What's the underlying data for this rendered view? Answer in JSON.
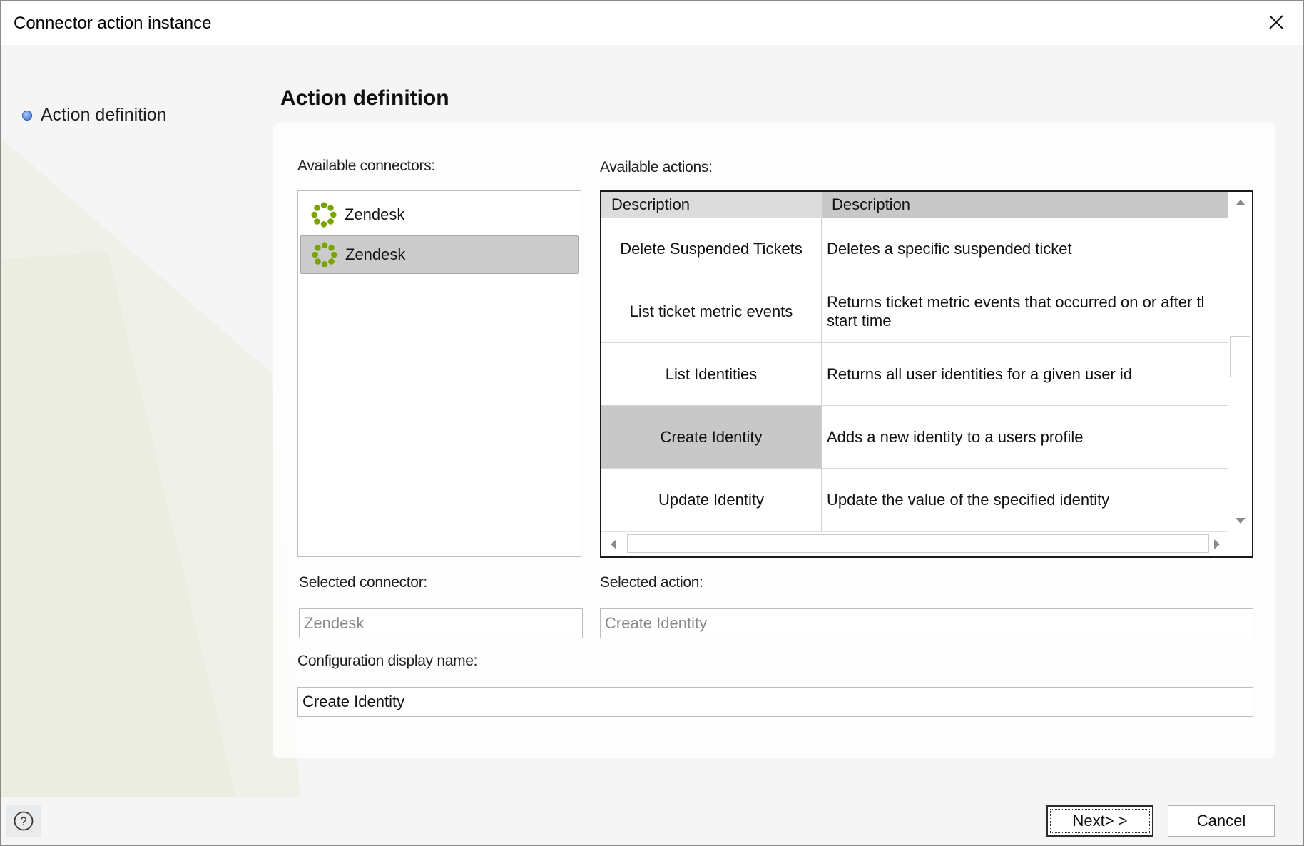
{
  "window": {
    "title": "Connector action instance"
  },
  "steps": [
    {
      "label": "Action definition"
    }
  ],
  "page": {
    "title": "Action definition"
  },
  "connectors": {
    "label": "Available connectors:",
    "items": [
      {
        "label": "Zendesk",
        "icon": "zendesk-icon",
        "selected": false
      },
      {
        "label": "Zendesk",
        "icon": "zendesk-icon",
        "selected": true
      }
    ]
  },
  "actions": {
    "label": "Available actions:",
    "columns": [
      "Description",
      "Description"
    ],
    "rows": [
      {
        "name": "Delete Suspended Tickets",
        "description": "Deletes a specific suspended ticket"
      },
      {
        "name": "List ticket metric events",
        "description": "Returns ticket metric events that occurred on or after tl\nstart time"
      },
      {
        "name": "List Identities",
        "description": "Returns all user identities for a given user id"
      },
      {
        "name": "Create Identity",
        "description": "Adds a new identity to a users profile",
        "selected": true
      },
      {
        "name": "Update Identity",
        "description": "Update the value of the specified identity"
      }
    ]
  },
  "selected_connector": {
    "label": "Selected connector:",
    "value": "Zendesk"
  },
  "selected_action": {
    "label": "Selected action:",
    "value": "Create Identity"
  },
  "config_name": {
    "label": "Configuration display name:",
    "value": "Create Identity"
  },
  "footer": {
    "next_label": "Next> >",
    "cancel_label": "Cancel",
    "help_icon": "help-circle-icon"
  },
  "colors": {
    "selection": "#c8c8c8",
    "zendesk_green": "#78a300",
    "step_dot": "#3b6fcf"
  }
}
